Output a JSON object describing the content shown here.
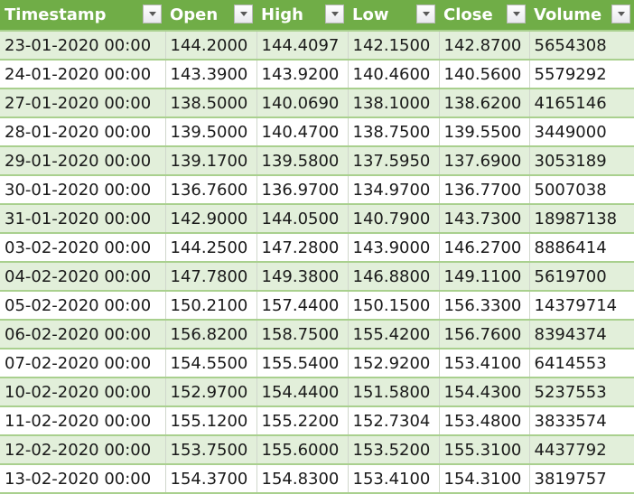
{
  "table": {
    "columns": [
      "Timestamp",
      "Open",
      "High",
      "Low",
      "Close",
      "Volume"
    ],
    "filter_icon": "filter-dropdown-icon",
    "colors": {
      "header_bg": "#70ad47",
      "header_text": "#ffffff",
      "band_row_bg": "#e2efda",
      "plain_row_bg": "#ffffff",
      "row_border": "#a9d08e"
    },
    "rows": [
      [
        "23-01-2020 00:00",
        "144.2000",
        "144.4097",
        "142.1500",
        "142.8700",
        "5654308"
      ],
      [
        "24-01-2020 00:00",
        "143.3900",
        "143.9200",
        "140.4600",
        "140.5600",
        "5579292"
      ],
      [
        "27-01-2020 00:00",
        "138.5000",
        "140.0690",
        "138.1000",
        "138.6200",
        "4165146"
      ],
      [
        "28-01-2020 00:00",
        "139.5000",
        "140.4700",
        "138.7500",
        "139.5500",
        "3449000"
      ],
      [
        "29-01-2020 00:00",
        "139.1700",
        "139.5800",
        "137.5950",
        "137.6900",
        "3053189"
      ],
      [
        "30-01-2020 00:00",
        "136.7600",
        "136.9700",
        "134.9700",
        "136.7700",
        "5007038"
      ],
      [
        "31-01-2020 00:00",
        "142.9000",
        "144.0500",
        "140.7900",
        "143.7300",
        "18987138"
      ],
      [
        "03-02-2020 00:00",
        "144.2500",
        "147.2800",
        "143.9000",
        "146.2700",
        "8886414"
      ],
      [
        "04-02-2020 00:00",
        "147.7800",
        "149.3800",
        "146.8800",
        "149.1100",
        "5619700"
      ],
      [
        "05-02-2020 00:00",
        "150.2100",
        "157.4400",
        "150.1500",
        "156.3300",
        "14379714"
      ],
      [
        "06-02-2020 00:00",
        "156.8200",
        "158.7500",
        "155.4200",
        "156.7600",
        "8394374"
      ],
      [
        "07-02-2020 00:00",
        "154.5500",
        "155.5400",
        "152.9200",
        "153.4100",
        "6414553"
      ],
      [
        "10-02-2020 00:00",
        "152.9700",
        "154.4400",
        "151.5800",
        "154.4300",
        "5237553"
      ],
      [
        "11-02-2020 00:00",
        "155.1200",
        "155.2200",
        "152.7304",
        "153.4800",
        "3833574"
      ],
      [
        "12-02-2020 00:00",
        "153.7500",
        "155.6000",
        "153.5200",
        "155.3100",
        "4437792"
      ],
      [
        "13-02-2020 00:00",
        "154.3700",
        "154.8300",
        "153.4100",
        "154.3100",
        "3819757"
      ]
    ]
  }
}
